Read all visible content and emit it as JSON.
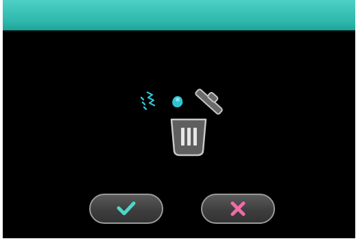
{
  "dialog": {
    "type": "delete-confirmation",
    "icon": "trash-can-open-lid-icon",
    "confirm_icon": "checkmark-icon",
    "cancel_icon": "x-close-icon"
  },
  "colors": {
    "title_bar": "#2fb8ad",
    "background": "#000000",
    "accent_cyan": "#2ec4d4",
    "confirm_check": "#4fd6c8",
    "cancel_x": "#f06ba8",
    "trash_gray": "#5f5f5f",
    "button_border": "#9a9a9a"
  }
}
